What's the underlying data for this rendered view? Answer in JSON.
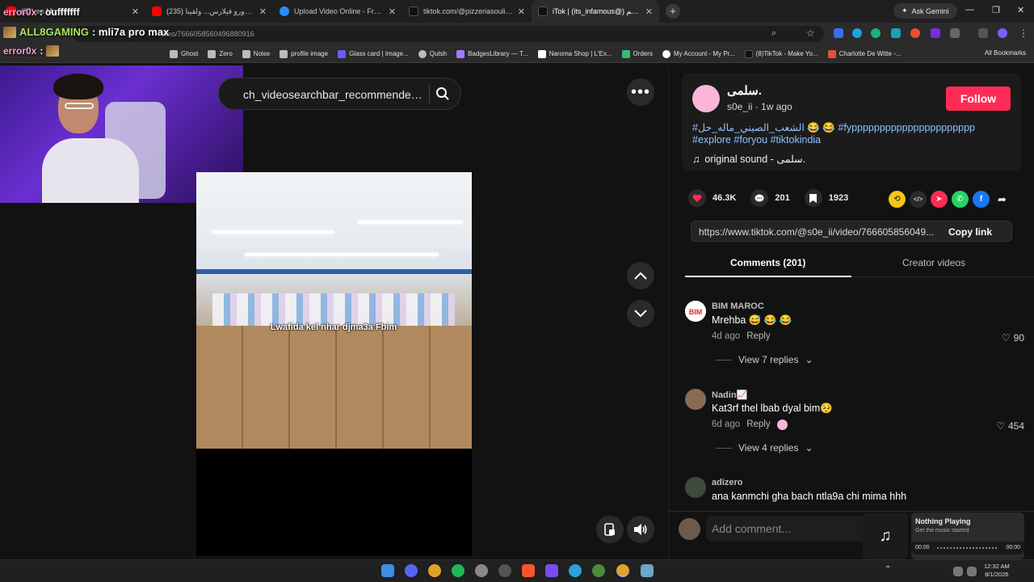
{
  "browser": {
    "tabs": [
      {
        "title": "(33) ee Mix 2024",
        "active": false,
        "color": "#ff0000"
      },
      {
        "title": "(235) خرجنا ندورو فيلارس... ولقينا",
        "active": false,
        "color": "#ff0000"
      },
      {
        "title": "Upload Video Online - Free Vid",
        "active": false,
        "color": "#2b8cff"
      },
      {
        "title": "tiktok.com/@pizzeriasouli33/liv",
        "active": false,
        "color": "#111111"
      },
      {
        "title": "iTok | (its_infamous@) كريم",
        "active": true,
        "color": "#111111"
      }
    ],
    "gemini_label": "Ask Gemini",
    "url": "ideo/7666058560496880916",
    "bookmarks": [
      {
        "label": "Ghost",
        "color": "#bbbbbb"
      },
      {
        "label": "Zero",
        "color": "#bbbbbb"
      },
      {
        "label": "Noise",
        "color": "#bbbbbb"
      },
      {
        "label": "profile image",
        "color": "#bbbbbb"
      },
      {
        "label": "Glass card | Image...",
        "color": "#6b5cff"
      },
      {
        "label": "Qutsh",
        "color": "#bbbbbb"
      },
      {
        "label": "BadgesLibrary — T...",
        "color": "#a07cff"
      },
      {
        "label": "Naroma Shop | L'Ex...",
        "color": "#ffffff"
      },
      {
        "label": "Orders",
        "color": "#2fbf71"
      },
      {
        "label": "My Account - My Pr...",
        "color": "#ffffff"
      },
      {
        "label": "(8)TikTok - Make Yo...",
        "color": "#111111"
      },
      {
        "label": "Charlotte De Witte -...",
        "color": "#e0503a"
      }
    ],
    "all_bookmarks": "All Bookmarks"
  },
  "overlay": {
    "line1_name": "error0x",
    "line1_msg": " : oufffffff",
    "line2_name": "ALL8GAMING",
    "line2_msg": " : mli7a pro max",
    "line3_name": "error0x",
    "line3_msg": " :"
  },
  "video": {
    "search_text": "ch_videosearchbar_recommended_...",
    "caption": "Lwafida kel nhar djma3a Fbim"
  },
  "post": {
    "author_name": "سلمى.",
    "author_handle": "s0e_ii · 1w ago",
    "follow_label": "Follow",
    "description": "#الشعب_الصيني_ماله_حل 😂 😂 #fypppppppppppppppppppppp #explore #foryou #tiktokindia",
    "sound": "original sound - سلمى.",
    "likes": "46.3K",
    "comments": "201",
    "saves": "1923",
    "link": "https://www.tiktok.com/@s0e_ii/video/766605856049...",
    "copy_label": "Copy link",
    "tab_comments": "Comments (201)",
    "tab_creator": "Creator videos"
  },
  "comments": [
    {
      "user": "BIM MAROC",
      "text": "Mrehba 😅 😂 😂",
      "age": "4d ago",
      "reply": "Reply",
      "likes": "90",
      "replies": "View 7 replies",
      "avatar_color": "#d62b2b"
    },
    {
      "user": "Nadin📈",
      "text": "Kat3rf thel lbab dyal bim🥺",
      "age": "6d ago",
      "reply": "Reply",
      "likes": "454",
      "replies": "View 4 replies",
      "avatar_color": "#8b6a55"
    },
    {
      "user": "adizero",
      "text": "ana kanmchi gha bach ntla9a chi mima hhh",
      "age": "",
      "reply": "",
      "likes": "",
      "replies": "",
      "avatar_color": "#3e4a3a"
    }
  ],
  "composer": {
    "placeholder": "Add comment..."
  },
  "music": {
    "title": "Nothing Playing",
    "subtitle": "Get the music started",
    "time_left": "00:00",
    "time_right": "00:00"
  },
  "clock": {
    "time": "12:32 AM",
    "date": "8/1/2026"
  }
}
